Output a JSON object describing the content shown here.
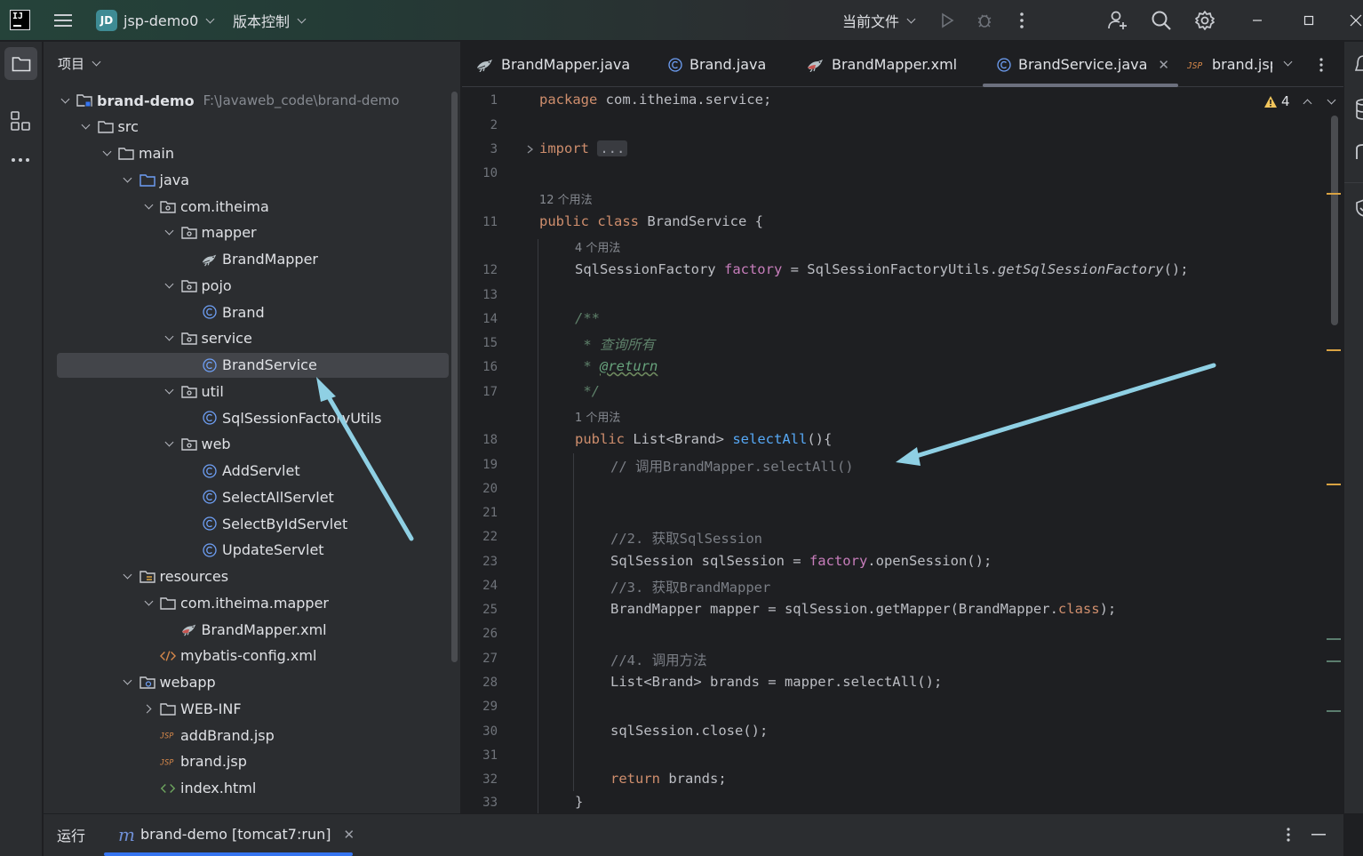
{
  "titlebar": {
    "project_badge": "JD",
    "project_name": "jsp-demo0",
    "vcs_label": "版本控制",
    "run_config": "当前文件"
  },
  "project_panel": {
    "header": "项目",
    "tree": [
      {
        "label": "brand-demo",
        "hint": "F:\\Javaweb_code\\brand-demo",
        "icon": "module-folder-icon",
        "arrow": "down",
        "depth": 0
      },
      {
        "label": "src",
        "icon": "folder-icon",
        "arrow": "down",
        "depth": 1
      },
      {
        "label": "main",
        "icon": "folder-icon",
        "arrow": "down",
        "depth": 2
      },
      {
        "label": "java",
        "icon": "source-folder-icon",
        "arrow": "down",
        "depth": 3
      },
      {
        "label": "com.itheima",
        "icon": "package-icon",
        "arrow": "down",
        "depth": 4
      },
      {
        "label": "mapper",
        "icon": "package-icon",
        "arrow": "down",
        "depth": 5
      },
      {
        "label": "BrandMapper",
        "icon": "mybatis-bird-icon",
        "arrow": "none",
        "depth": 6
      },
      {
        "label": "pojo",
        "icon": "package-icon",
        "arrow": "down",
        "depth": 5
      },
      {
        "label": "Brand",
        "icon": "class-icon",
        "arrow": "none",
        "depth": 6
      },
      {
        "label": "service",
        "icon": "package-icon",
        "arrow": "down",
        "depth": 5
      },
      {
        "label": "BrandService",
        "icon": "class-icon",
        "arrow": "none",
        "depth": 6,
        "selected": true
      },
      {
        "label": "util",
        "icon": "package-icon",
        "arrow": "down",
        "depth": 5
      },
      {
        "label": "SqlSessionFactoryUtils",
        "icon": "class-icon",
        "arrow": "none",
        "depth": 6
      },
      {
        "label": "web",
        "icon": "package-icon",
        "arrow": "down",
        "depth": 5
      },
      {
        "label": "AddServlet",
        "icon": "class-icon",
        "arrow": "none",
        "depth": 6
      },
      {
        "label": "SelectAllServlet",
        "icon": "class-icon",
        "arrow": "none",
        "depth": 6
      },
      {
        "label": "SelectByIdServlet",
        "icon": "class-icon",
        "arrow": "none",
        "depth": 6
      },
      {
        "label": "UpdateServlet",
        "icon": "class-icon",
        "arrow": "none",
        "depth": 6
      },
      {
        "label": "resources",
        "icon": "resources-folder-icon",
        "arrow": "down",
        "depth": 3
      },
      {
        "label": "com.itheima.mapper",
        "icon": "folder-icon",
        "arrow": "down",
        "depth": 4
      },
      {
        "label": "BrandMapper.xml",
        "icon": "mybatis-bird-red-icon",
        "arrow": "none",
        "depth": 5
      },
      {
        "label": "mybatis-config.xml",
        "icon": "xml-icon",
        "arrow": "none",
        "depth": 4
      },
      {
        "label": "webapp",
        "icon": "web-folder-icon",
        "arrow": "down",
        "depth": 3
      },
      {
        "label": "WEB-INF",
        "icon": "folder-icon",
        "arrow": "right",
        "depth": 4
      },
      {
        "label": "addBrand.jsp",
        "icon": "jsp-icon",
        "arrow": "none",
        "depth": 4
      },
      {
        "label": "brand.jsp",
        "icon": "jsp-icon",
        "arrow": "none",
        "depth": 4
      },
      {
        "label": "index.html",
        "icon": "html-icon",
        "arrow": "none",
        "depth": 4
      }
    ]
  },
  "editor": {
    "tabs": [
      {
        "label": "BrandMapper.java",
        "icon": "mybatis-bird-icon"
      },
      {
        "label": "Brand.java",
        "icon": "class-icon"
      },
      {
        "label": "BrandMapper.xml",
        "icon": "mybatis-bird-red-icon"
      },
      {
        "label": "BrandService.java",
        "icon": "class-icon",
        "active": true
      },
      {
        "label": "brand.jsp",
        "icon": "jsp-icon"
      }
    ],
    "warning_count": "4",
    "line_numbers": [
      "1",
      "2",
      "3",
      "10",
      "11",
      "12",
      "13",
      "14",
      "15",
      "16",
      "17",
      "18",
      "19",
      "20",
      "21",
      "22",
      "23",
      "24",
      "25",
      "26",
      "27",
      "28",
      "29",
      "30",
      "31",
      "32",
      "33"
    ],
    "usage_hints": {
      "class": "12 个用法",
      "field": "4 个用法",
      "method": "1 个用法"
    },
    "code": {
      "l1_kw": "package",
      "l1_rest": " com.itheima.service;",
      "l3_kw": "import",
      "l3_fold": "...",
      "l11_kw": "public class",
      "l11_rest": " BrandService {",
      "l12_type": "SqlSessionFactory ",
      "l12_field": "factory",
      "l12_mid": " = SqlSessionFactoryUtils.",
      "l12_call": "getSqlSessionFactory",
      "l12_end": "();",
      "l14": "/**",
      "l15": " * 查询所有",
      "l16_pre": " * ",
      "l16_tag": "@return",
      "l17": " */",
      "l18_kw": "public",
      "l18_mid": " List<Brand> ",
      "l18_fn": "selectAll",
      "l18_end": "(){",
      "l19": "// 调用BrandMapper.selectAll()",
      "l22": "//2. 获取SqlSession",
      "l23_pre": "SqlSession sqlSession = ",
      "l23_field": "factory",
      "l23_end": ".openSession();",
      "l24": "//3. 获取BrandMapper",
      "l25_pre": "BrandMapper mapper = sqlSession.getMapper(BrandMapper.",
      "l25_kw": "class",
      "l25_end": ");",
      "l27": "//4. 调用方法",
      "l28": "List<Brand> brands = mapper.selectAll();",
      "l30": "sqlSession.close();",
      "l32_kw": "return",
      "l32_rest": " brands;",
      "l33": "}"
    }
  },
  "bottombar": {
    "run_label": "运行",
    "run_tab": "brand-demo [tomcat7:run]"
  },
  "colors": {
    "accent": "#3574f0",
    "annotation_arrow": "#8fd0e4",
    "keyword": "#cf8e6d",
    "field": "#c77dbb",
    "function": "#56a8f5"
  }
}
